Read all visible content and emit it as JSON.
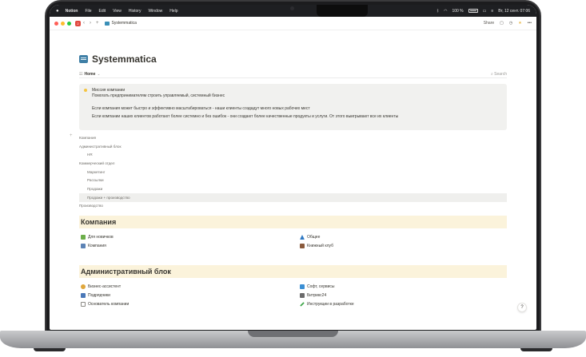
{
  "menubar": {
    "app": "Notion",
    "items": [
      "File",
      "Edit",
      "View",
      "History",
      "Window",
      "Help"
    ],
    "battery_percent": "100 %",
    "datetime": "Вт, 12 сент. 07:06"
  },
  "topbar": {
    "notifications": "2",
    "breadcrumb": "Systemmatica",
    "share": "Share"
  },
  "page": {
    "title": "Systemmatica",
    "view_label": "Home",
    "search": "Search"
  },
  "callout": {
    "heading": "Миссия компании",
    "line1": "Помогать предпринимателям строить управляемый, системный бизнес",
    "line2": "Если компания может быстро и эффективно масштабироваться - наши клиенты создадут много новых рабочих мест",
    "line3": "Если компании наших клиентов работают более системно и без ошибок - они создают более качественные продукты и услуги. От этого выигрывают все их клиенты"
  },
  "tree": {
    "items": [
      {
        "label": "Компания",
        "indent": 0
      },
      {
        "label": "Административный блок",
        "indent": 0
      },
      {
        "label": "HR",
        "indent": 1
      },
      {
        "label": "Коммерческий отдел",
        "indent": 0
      },
      {
        "label": "Маркетинг",
        "indent": 1
      },
      {
        "label": "Рассылки",
        "indent": 1
      },
      {
        "label": "Продажи",
        "indent": 1
      },
      {
        "label": "Продажи + производство",
        "indent": 1
      },
      {
        "label": "Производство",
        "indent": 0
      }
    ]
  },
  "sections": {
    "company": {
      "heading": "Компания",
      "left": [
        "Для новичков",
        "Компания"
      ],
      "right": [
        "Общее",
        "Книжный клуб"
      ]
    },
    "admin": {
      "heading": "Административный блок",
      "left": [
        "Бизнес-ассистент",
        "Подрядчики",
        "Основатель компании"
      ],
      "right": [
        "Софт, сервисы",
        "Битрикс24",
        "Инструкции в разработке"
      ]
    }
  },
  "help": "?",
  "colors": {
    "heading_bg": "#fbf3db",
    "callout_bg": "#f1f1ef",
    "accent_blue": "#3f7fa6"
  }
}
